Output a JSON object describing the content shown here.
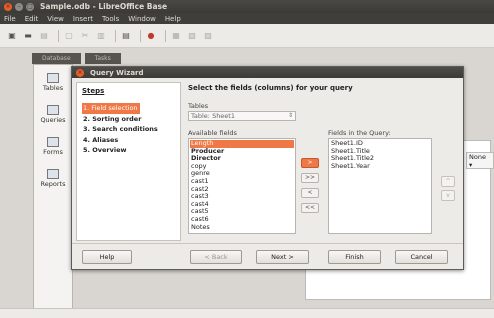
{
  "window": {
    "title": "Sample.odb - LibreOffice Base",
    "controls": [
      "×",
      "–",
      "□"
    ]
  },
  "menubar": [
    "File",
    "Edit",
    "View",
    "Insert",
    "Tools",
    "Window",
    "Help"
  ],
  "background": {
    "tabs": [
      "Database",
      "Tasks"
    ],
    "left_panel": [
      "Tables",
      "Queries",
      "Forms",
      "Reports"
    ],
    "right_label": "None"
  },
  "wizard": {
    "title": "Query Wizard",
    "close_glyph": "×",
    "steps_title": "Steps",
    "steps": [
      "1. Field selection",
      "2. Sorting order",
      "3. Search conditions",
      "4. Aliases",
      "5. Overview"
    ],
    "active_step": 0,
    "heading": "Select the fields (columns) for your query",
    "tables_label": "Tables",
    "table_value": "Table: Sheet1",
    "available_label": "Available fields",
    "available_fields": [
      "Length",
      "Producer",
      "Director",
      "copy",
      "genre",
      "cast1",
      "cast2",
      "cast3",
      "cast4",
      "cast5",
      "cast6",
      "Notes"
    ],
    "available_selected": 0,
    "query_label": "Fields in the Query:",
    "query_fields": [
      "Sheet1.ID",
      "Sheet1.Title",
      "Sheet1.Title2",
      "Sheet1.Year"
    ],
    "move_buttons": [
      ">",
      ">>",
      "<",
      "<<"
    ],
    "order_buttons": [
      "^",
      "v"
    ],
    "buttons": {
      "help": "Help",
      "back": "< Back",
      "next": "Next >",
      "finish": "Finish",
      "cancel": "Cancel"
    }
  }
}
